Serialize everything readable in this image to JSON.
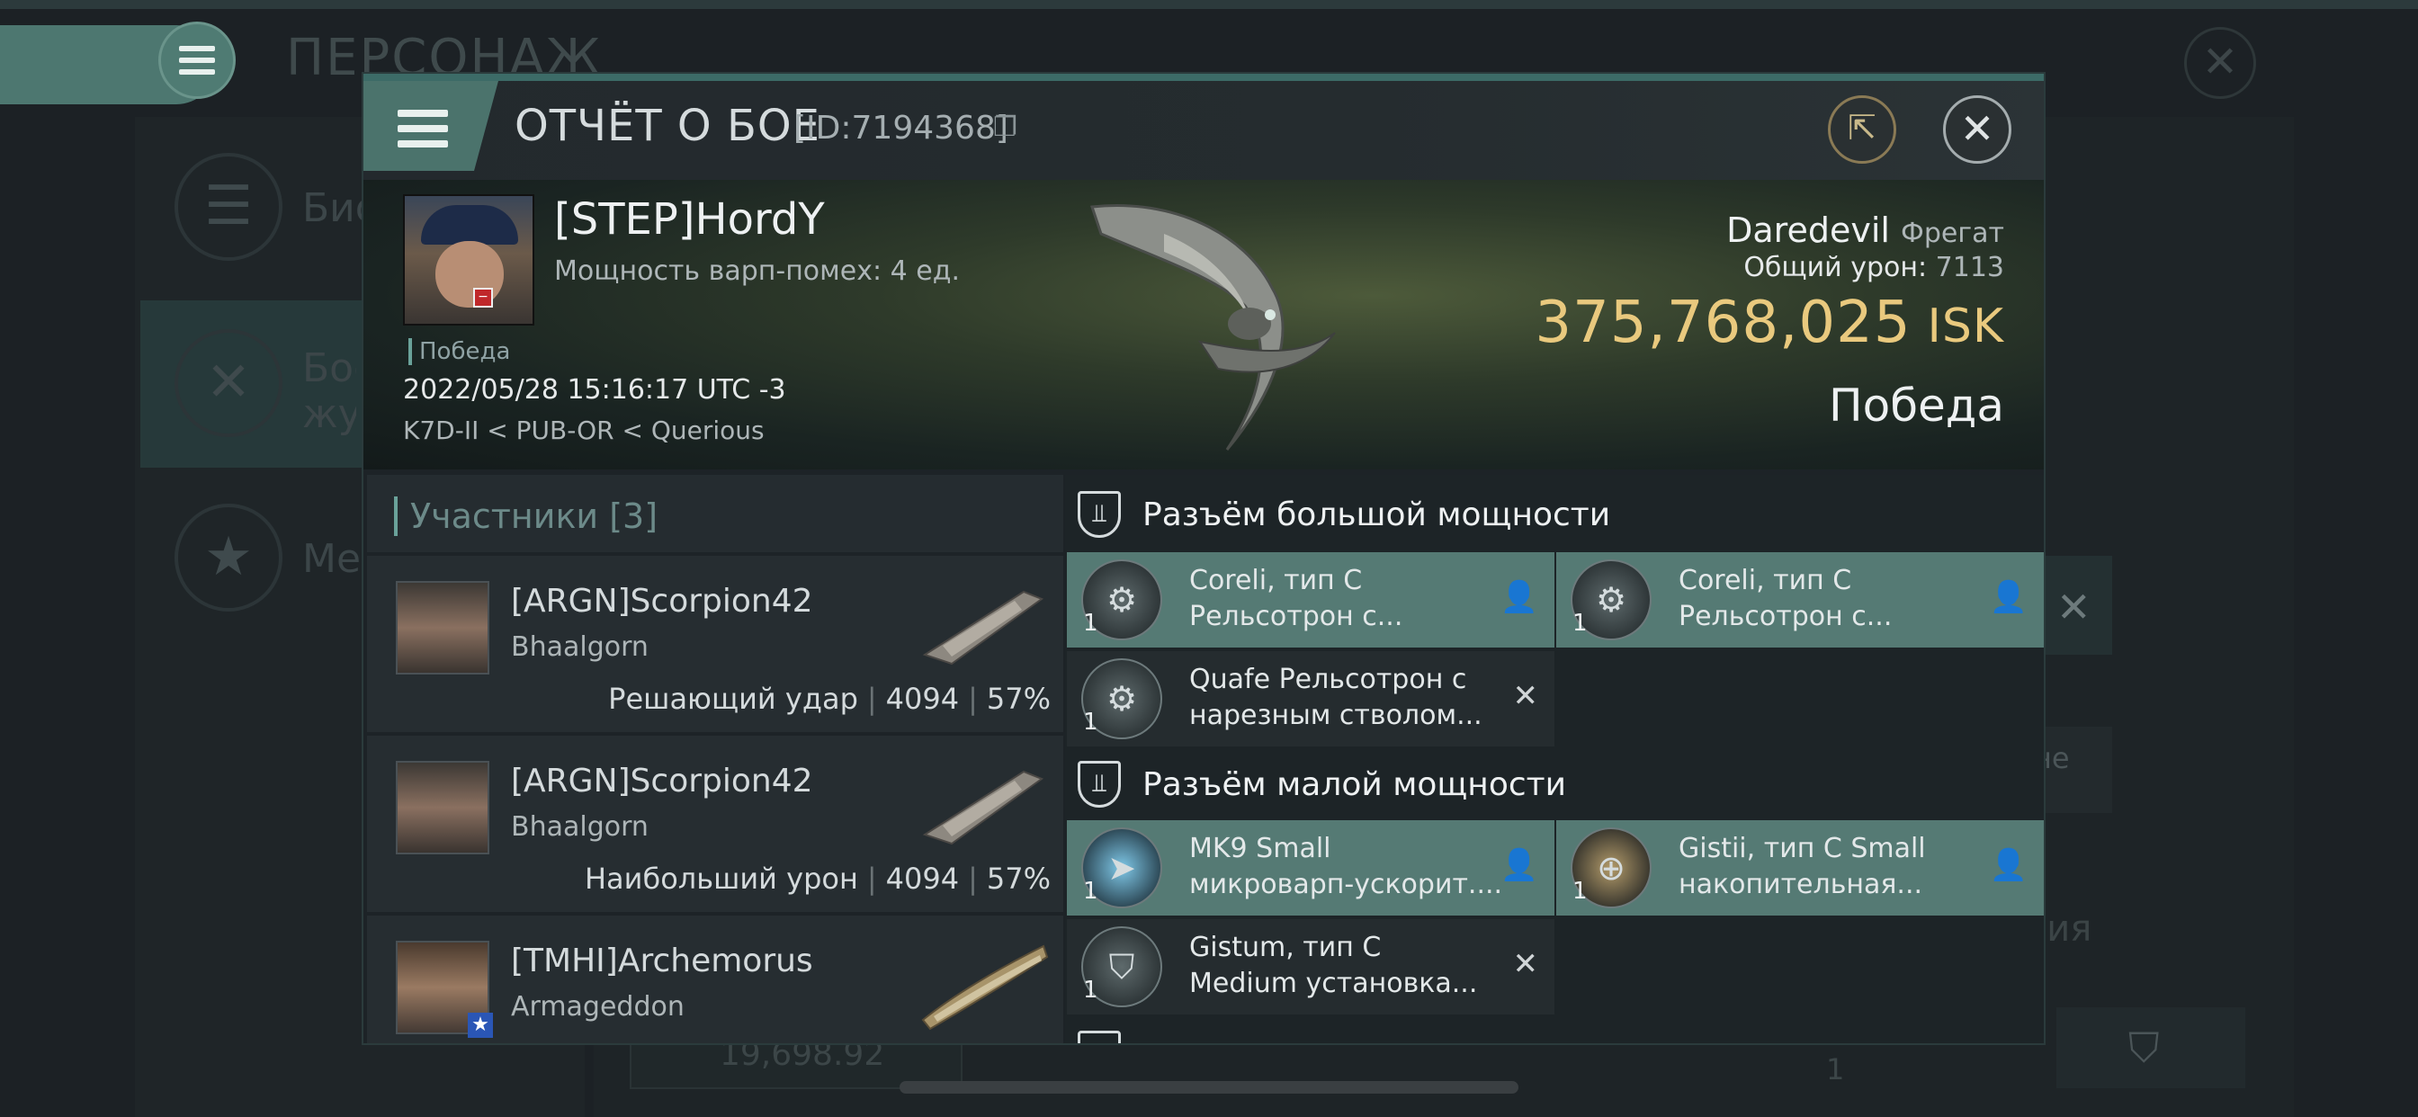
{
  "background": {
    "title": "ПЕРСОНАЖ",
    "side_items": [
      "Био",
      "Бое жур",
      "Мед"
    ],
    "bottom_value": "19,698.92",
    "bottom_qty": "1",
    "right_text_1": "не",
    "right_text_2": "ция"
  },
  "header": {
    "title": "ОТЧЁТ О БОЕ",
    "id": "[ID:7194368]"
  },
  "victim": {
    "name": "[STEP]HordY",
    "warp_strength": "Мощность варп-помех: 4 ед.",
    "result_tag": "Победа",
    "datetime": "2022/05/28 15:16:17 UTC -3",
    "location": "K7D-II < PUB-OR < Querious",
    "ship_name": "Daredevil",
    "ship_class": "Фрегат",
    "damage_label": "Общий урон:",
    "damage_value": "7113",
    "isk_value": "375,768,025",
    "isk_currency": "ISK",
    "outcome": "Победа"
  },
  "participants": {
    "label": "Участники [3]",
    "rows": [
      {
        "name": "[ARGN]Scorpion42",
        "ship": "Bhaalgorn",
        "role": "Решающий удар",
        "damage": "4094",
        "percent": "57%"
      },
      {
        "name": "[ARGN]Scorpion42",
        "ship": "Bhaalgorn",
        "role": "Наибольший урон",
        "damage": "4094",
        "percent": "57%"
      },
      {
        "name": "[TMHI]Archemorus",
        "ship": "Armageddon",
        "role": "",
        "damage": "",
        "percent": ""
      }
    ]
  },
  "high_slots": {
    "label": "Разъём большой мощности",
    "items": [
      {
        "line1": "Coreli, тип C",
        "line2": "Рельсотрон с...",
        "qty": "1",
        "status": "fitted"
      },
      {
        "line1": "Coreli, тип C",
        "line2": "Рельсотрон с...",
        "qty": "1",
        "status": "fitted"
      },
      {
        "line1": "Quafe Рельсотрон с",
        "line2": "нарезным стволом...",
        "qty": "1",
        "status": "destroyed"
      }
    ]
  },
  "mid_slots": {
    "label": "Разъём малой мощности",
    "items": [
      {
        "line1": "MK9 Small",
        "line2": "микроварп-ускорит....",
        "qty": "1",
        "status": "fitted"
      },
      {
        "line1": "Gistii, тип C Small",
        "line2": "накопительная...",
        "qty": "1",
        "status": "fitted"
      },
      {
        "line1": "Gistum, тип C",
        "line2": "Medium установка...",
        "qty": "1",
        "status": "destroyed"
      }
    ]
  },
  "colors": {
    "accent": "#557a74",
    "isk": "#e9c97e",
    "badge_red": "#c0282a"
  }
}
